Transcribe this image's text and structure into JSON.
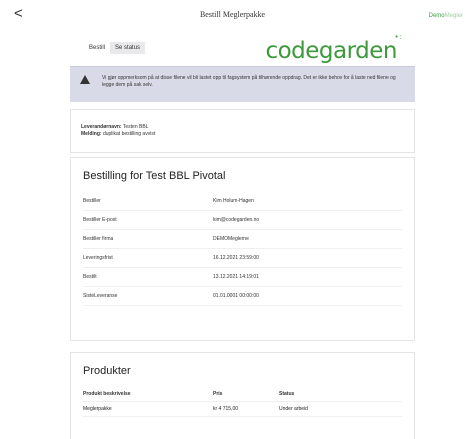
{
  "header": {
    "back_glyph": "<",
    "title": "Bestill Meglerpakke",
    "brand_a": "Demo",
    "brand_b": "Megler"
  },
  "tabs": [
    {
      "label": "Bestill",
      "active": false
    },
    {
      "label": "Se status",
      "active": true
    }
  ],
  "logo": {
    "text": "codegarden",
    "dots": "•:"
  },
  "warning": {
    "icon": "warning-triangle-icon",
    "text": "Vi gjør oppmerksom på at disse filene vil bli lastet opp til fagsystem på tilhørende oppdrag. Det er ikke behov for å laste ned filene og legge dem på sak selv."
  },
  "info": {
    "supplier_label": "Leverandørnavn:",
    "supplier_value": "Testen BBL",
    "message_label": "Melding:",
    "message_value": "duplikat bestilling avvist"
  },
  "order": {
    "title": "Bestilling for Test BBL Pivotal",
    "rows": [
      {
        "key": "Bestiller",
        "value": "Kim Holum-Hagen"
      },
      {
        "key": "Bestiller E-post",
        "value": "kim@codegarden.no"
      },
      {
        "key": "Bestiller firma",
        "value": "DEMOMeglerne"
      },
      {
        "key": "Leveringsfrist",
        "value": "16.12.2021 23:59:00"
      },
      {
        "key": "Bestilt",
        "value": "13.12.2021 14:19:01"
      },
      {
        "key": "SisteLeveranse",
        "value": "01.01.0001 00:00:00"
      }
    ]
  },
  "products": {
    "title": "Produkter",
    "headers": [
      "Produkt beskrivelse",
      "Pris",
      "Status"
    ],
    "rows": [
      {
        "desc": "Meglerpakke",
        "price": "kr 4 715,00",
        "status": "Under arbeid"
      }
    ]
  }
}
